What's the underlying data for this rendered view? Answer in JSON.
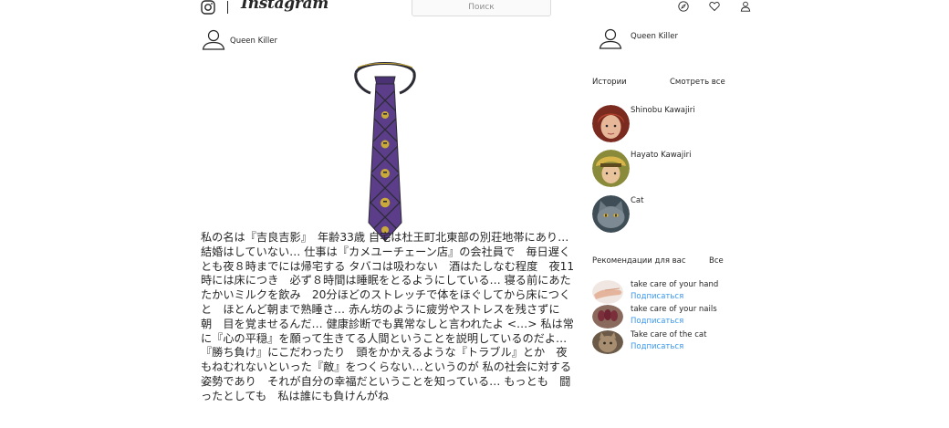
{
  "header": {
    "logo_text": "Instagram",
    "search_placeholder": "Поиск",
    "nav_icons": [
      "explore-icon",
      "heart-icon",
      "profile-icon"
    ]
  },
  "post": {
    "author": "Queen Killer",
    "image_caption": "",
    "text": "私の名は『吉良吉影』　年齢33歳 自宅は杜王町北東部の別荘地帯にあり…　結婚はしていない… 仕事は『カメユーチェーン店』の会社員で　毎日遅くとも夜８時までには帰宅する タバコは吸わない　酒はたしなむ程度　夜11時には床につき　必ず８時間は睡眠をとるようにしている… 寝る前にあたたかいミルクを飲み　20分ほどのストレッチで体をほぐしてから床につくと　ほとんど朝まで熟睡さ… 赤ん坊のように疲労やストレスを残さずに　朝　目を覚ませるんだ… 健康診断でも異常なしと言われたよ <…> 私は常に『心の平穏』を願って生きてる人間ということを説明しているのだよ… 『勝ち負け』にこだわったり　頭をかかえるような『トラブル』とか　夜もねむれないといった『敵』をつくらない…というのが 私の社会に対する姿勢であり　それが自分の幸福だということを知っている… もっとも　闘ったとしても　私は誰にも負けんがね"
  },
  "sidebar": {
    "username": "Queen Killer",
    "stories": {
      "title": "Истории",
      "see_all": "Смотреть все",
      "items": [
        {
          "name": "Shinobu Kawajiri"
        },
        {
          "name": "Hayato Kawajiri"
        },
        {
          "name": "Cat"
        }
      ]
    },
    "recommendations": {
      "title": "Рекомендации для вас",
      "all": "Все",
      "items": [
        {
          "name": "take care of your hand",
          "action": "Подписаться"
        },
        {
          "name": "take care of your nails",
          "action": "Подписаться"
        },
        {
          "name": "Take care of the cat",
          "action": "Подписаться"
        }
      ]
    }
  },
  "colors": {
    "text": "#262626",
    "muted": "#8e8e8e",
    "link": "#3897f0",
    "border": "#dbdbdb",
    "tie_purple": "#5b3d8a",
    "tie_gold": "#c9a93a"
  }
}
